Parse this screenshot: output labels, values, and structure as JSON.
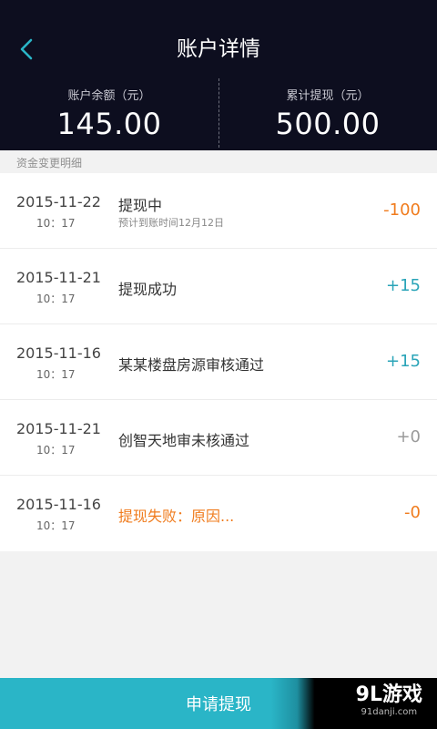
{
  "header": {
    "title": "账户详情",
    "back_icon": "chevron-left-icon",
    "accent": "#2ab5c7"
  },
  "summary": {
    "balance_label": "账户余额（元）",
    "balance_value": "145.00",
    "withdrawn_label": "累计提现（元）",
    "withdrawn_value": "500.00"
  },
  "section_label": "资金变更明细",
  "records": [
    {
      "date": "2015-11-22",
      "time": "10：17",
      "desc": "提现中",
      "sub": "预计到账时间12月12日",
      "amount": "-100",
      "color": "#f07c1e"
    },
    {
      "date": "2015-11-21",
      "time": "10：17",
      "desc": "提现成功",
      "sub": "",
      "amount": "+15",
      "color": "#2aa4b8"
    },
    {
      "date": "2015-11-16",
      "time": "10：17",
      "desc": "某某楼盘房源审核通过",
      "sub": "",
      "amount": "+15",
      "color": "#2aa4b8"
    },
    {
      "date": "2015-11-21",
      "time": "10：17",
      "desc": "创智天地审未核通过",
      "sub": "",
      "amount": "+0",
      "color": "#9a9a9a"
    },
    {
      "date": "2015-11-16",
      "time": "10：17",
      "desc": "提现失败：原因...",
      "sub": "",
      "amount": "-0",
      "color": "#f07c1e",
      "desc_color": "#f07c1e"
    }
  ],
  "footer": {
    "apply_label": "申请提现",
    "watermark_logo": "9L游戏",
    "watermark_url": "91danji.com"
  }
}
